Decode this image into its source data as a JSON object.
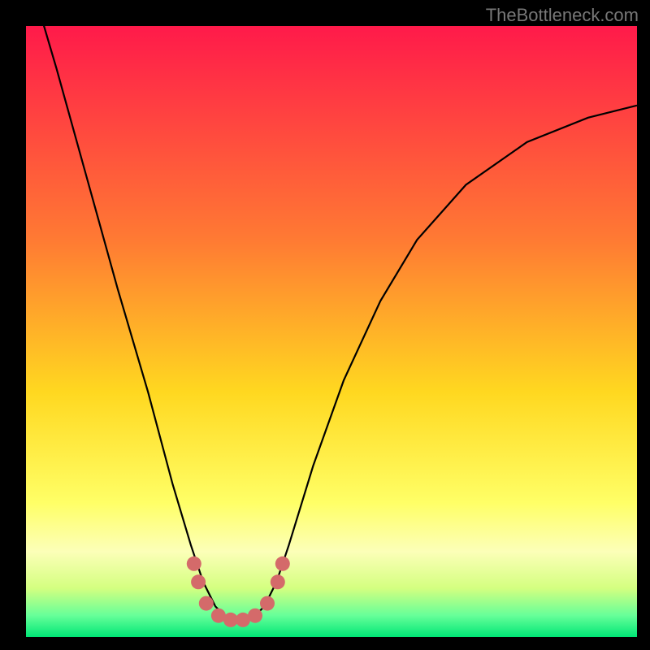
{
  "watermark": "TheBottleneck.com",
  "chart_data": {
    "type": "line",
    "title": "",
    "xlabel": "",
    "ylabel": "",
    "xlim": [
      0,
      100
    ],
    "ylim": [
      0,
      100
    ],
    "background_gradient": {
      "stops": [
        {
          "offset": 0.0,
          "color": "#ff1a4a"
        },
        {
          "offset": 0.35,
          "color": "#ff7a33"
        },
        {
          "offset": 0.6,
          "color": "#ffd820"
        },
        {
          "offset": 0.78,
          "color": "#ffff66"
        },
        {
          "offset": 0.86,
          "color": "#fcffb8"
        },
        {
          "offset": 0.92,
          "color": "#d4ff80"
        },
        {
          "offset": 0.965,
          "color": "#66ff99"
        },
        {
          "offset": 1.0,
          "color": "#00e676"
        }
      ]
    },
    "curve": {
      "x": [
        0,
        5,
        10,
        15,
        20,
        24,
        27,
        29,
        31,
        33,
        35,
        37,
        39,
        41,
        43,
        47,
        52,
        58,
        64,
        72,
        82,
        92,
        100
      ],
      "y": [
        110,
        93,
        75,
        57,
        40,
        25,
        15,
        9,
        5,
        3,
        2.5,
        3,
        5,
        9,
        15,
        28,
        42,
        55,
        65,
        74,
        81,
        85,
        87
      ]
    },
    "markers": {
      "color": "#d46a6a",
      "points": [
        {
          "x": 27.5,
          "y": 12
        },
        {
          "x": 28.2,
          "y": 9
        },
        {
          "x": 29.5,
          "y": 5.5
        },
        {
          "x": 31.5,
          "y": 3.5
        },
        {
          "x": 33.5,
          "y": 2.8
        },
        {
          "x": 35.5,
          "y": 2.8
        },
        {
          "x": 37.5,
          "y": 3.5
        },
        {
          "x": 39.5,
          "y": 5.5
        },
        {
          "x": 41.2,
          "y": 9
        },
        {
          "x": 42.0,
          "y": 12
        }
      ]
    }
  }
}
